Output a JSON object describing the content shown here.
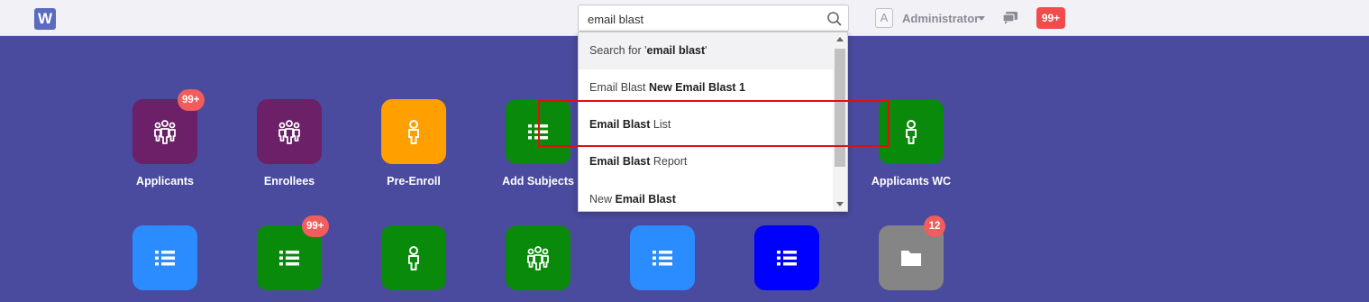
{
  "header": {
    "logo_letter": "W",
    "search": {
      "value": "email blast",
      "placeholder": ""
    },
    "user": {
      "avatar_letter": "A",
      "name": "Administrator"
    },
    "notifications": "99+"
  },
  "dropdown": {
    "items": [
      {
        "prefix": "Search for '",
        "bold": "email blast",
        "suffix": "'"
      },
      {
        "prefix": "Email Blast ",
        "bold": "New Email Blast 1",
        "suffix": ""
      },
      {
        "prefix": "",
        "bold": "Email Blast",
        "suffix": " List"
      },
      {
        "prefix": "",
        "bold": "Email Blast",
        "suffix": " Report"
      },
      {
        "prefix": "New ",
        "bold": "Email Blast",
        "suffix": ""
      }
    ]
  },
  "tiles_row1": [
    {
      "label": "Applicants",
      "icon": "group-icon",
      "color": "#6b2067",
      "badge": "99+"
    },
    {
      "label": "Enrollees",
      "icon": "group-icon",
      "color": "#6b2067",
      "badge": ""
    },
    {
      "label": "Pre-Enroll",
      "icon": "person-icon",
      "color": "#ffa000",
      "badge": ""
    },
    {
      "label": "Add Subjects",
      "icon": "list-icon",
      "color": "#0a8a0a",
      "badge": ""
    },
    {
      "label": "Applicants WC",
      "icon": "person-icon",
      "color": "#0a8a0a",
      "badge": ""
    }
  ],
  "tiles_row2": [
    {
      "icon": "list-icon",
      "color": "#2a8cff",
      "badge": ""
    },
    {
      "icon": "list-icon",
      "color": "#0a8a0a",
      "badge": "99+"
    },
    {
      "icon": "person-icon",
      "color": "#0a8a0a",
      "badge": ""
    },
    {
      "icon": "group-icon",
      "color": "#0a8a0a",
      "badge": ""
    },
    {
      "icon": "list-icon",
      "color": "#2a8cff",
      "badge": ""
    },
    {
      "icon": "list-icon",
      "color": "#0000ff",
      "badge": ""
    },
    {
      "icon": "folder-icon",
      "color": "#858585",
      "badge": "12"
    }
  ]
}
